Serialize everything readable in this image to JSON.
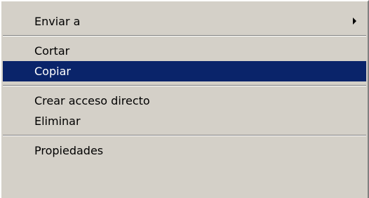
{
  "context_menu": {
    "items": [
      {
        "label": "Enviar a",
        "submenu_icon": "submenu-arrow-icon"
      },
      {
        "label": "Cortar"
      },
      {
        "label": "Copiar",
        "selected": true
      },
      {
        "label": "Crear acceso directo"
      },
      {
        "label": "Eliminar"
      },
      {
        "label": "Propiedades"
      }
    ]
  },
  "colors": {
    "menu_background": "#d4d0c8",
    "selection_background": "#0a246a",
    "selection_text": "#ffffff",
    "text": "#000000"
  }
}
